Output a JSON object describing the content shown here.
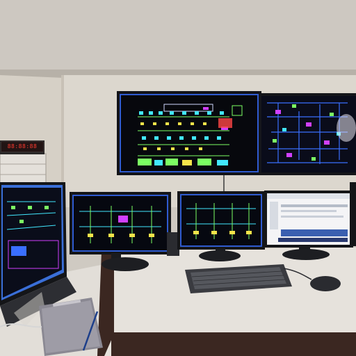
{
  "scene": {
    "description_free": true,
    "clock_display": "88:88:88"
  },
  "colors": {
    "ceiling": "#cac6c0",
    "wall": "#ddd8cf",
    "desk_top": "#e6e2dc",
    "desk_edge": "#3a2620",
    "screen_dark": "#0a0c14",
    "bezel": "#15161a",
    "blue_frame": "#3a6fd8",
    "neon_green": "#7cff63",
    "neon_cyan": "#42e8ff",
    "neon_magenta": "#d040ff",
    "neon_yellow": "#f5e44a",
    "neon_red": "#ff4646",
    "clock_red": "#ff3b30"
  },
  "objects": {
    "wall_monitor_left": "wall-mounted-monitor",
    "wall_monitor_right": "wall-mounted-monitor",
    "desk_monitor_1": "desk-monitor",
    "desk_monitor_2": "desk-monitor",
    "desk_monitor_3": "desk-monitor",
    "desk_monitor_4": "desk-monitor",
    "laptop": "laptop",
    "keyboard": "keyboard",
    "mouse": "mouse",
    "notebook": "notebook",
    "pen": "pen",
    "clock": "digital-clock"
  }
}
